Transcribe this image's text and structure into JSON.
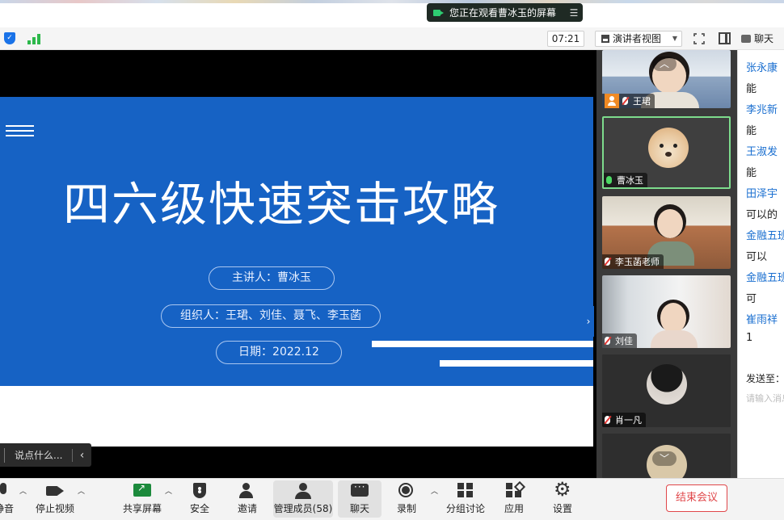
{
  "banner": {
    "text": "您正在观看曹冰玉的屏幕",
    "menu_icon": "menu-lines-icon",
    "accent": "#2ecc71"
  },
  "toolbar": {
    "timer": "07:21",
    "view_label": "演讲者视图",
    "chat_label": "聊天"
  },
  "slide": {
    "title": "四六级快速突击攻略",
    "presenter": "主讲人：曹冰玉",
    "organizers": "组织人：王珺、刘佳、聂飞、李玉菡",
    "date": "日期：2022.12",
    "brand_color": "#1662c4"
  },
  "say_box": {
    "placeholder": "说点什么..."
  },
  "participants": [
    {
      "name": "王珺",
      "host": true
    },
    {
      "name": "曹冰玉",
      "active": true
    },
    {
      "name": "李玉菡老师"
    },
    {
      "name": "刘佳"
    },
    {
      "name": "肖一凡"
    },
    {
      "name": ""
    }
  ],
  "chat": {
    "messages": [
      {
        "name": "张永康",
        "text": "能"
      },
      {
        "name": "李兆新",
        "text": "能"
      },
      {
        "name": "王淑发",
        "text": "能"
      },
      {
        "name": "田泽宇",
        "text": "可以的"
      },
      {
        "name": "金融五班",
        "text": "可以"
      },
      {
        "name": "金融五班",
        "text": "可"
      },
      {
        "name": "崔雨祥",
        "text": "1"
      }
    ],
    "send_to": "发送至：",
    "input_placeholder": "请输入消息"
  },
  "bottombar": {
    "mute_label": "静音",
    "video_label": "停止视频",
    "share_label": "共享屏幕",
    "security_label": "安全",
    "invite_label": "邀请",
    "participants_label": "管理成员(58)",
    "chat_label": "聊天",
    "record_label": "录制",
    "breakout_label": "分组讨论",
    "apps_label": "应用",
    "settings_label": "设置",
    "end_label": "结束会议",
    "end_color": "#e0474a"
  }
}
